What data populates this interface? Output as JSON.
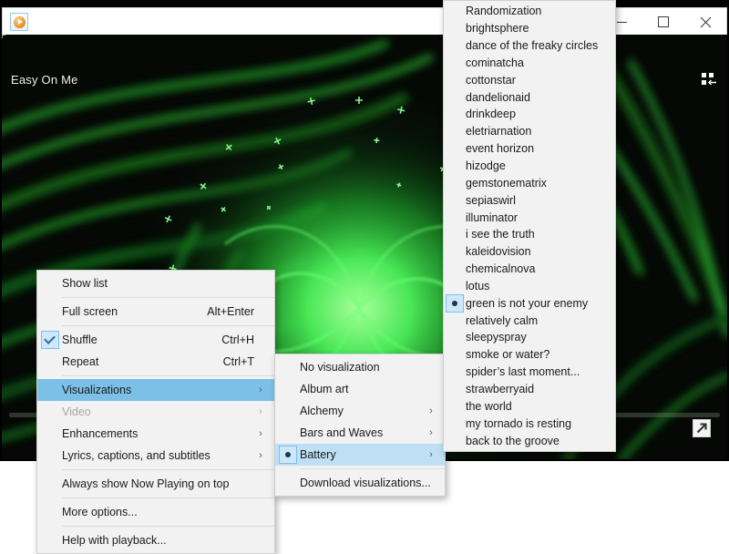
{
  "window": {
    "title": "",
    "app_icon": "media-player-icon",
    "controls": {
      "minimize": "–",
      "maximize": "□",
      "close": "✕"
    }
  },
  "now_playing": {
    "track_title": "Easy On Me",
    "switch_to_library_icon": "switch-to-library-icon",
    "expand_icon": "full-screen-icon",
    "visualization_name": "green is not your enemy",
    "visualization_colors": {
      "background": "#050805",
      "glow": "#2fd94a",
      "bright": "#7dff8a"
    }
  },
  "context_menu": {
    "items": [
      {
        "label": "Show list",
        "accel": "",
        "arrow": false,
        "sep_after": true
      },
      {
        "label": "Full screen",
        "accel": "Alt+Enter",
        "arrow": false,
        "sep_after": true
      },
      {
        "label": "Shuffle",
        "accel": "Ctrl+H",
        "arrow": false,
        "checked": true
      },
      {
        "label": "Repeat",
        "accel": "Ctrl+T",
        "arrow": false,
        "sep_after": true
      },
      {
        "label": "Visualizations",
        "accel": "",
        "arrow": true,
        "selected": true
      },
      {
        "label": "Video",
        "accel": "",
        "arrow": true,
        "disabled": true
      },
      {
        "label": "Enhancements",
        "accel": "",
        "arrow": true
      },
      {
        "label": "Lyrics, captions, and subtitles",
        "accel": "",
        "arrow": true,
        "sep_after": true
      },
      {
        "label": "Always show Now Playing on top",
        "accel": "",
        "arrow": false,
        "sep_after": true
      },
      {
        "label": "More options...",
        "accel": "",
        "arrow": false,
        "sep_after": true
      },
      {
        "label": "Help with playback...",
        "accel": "",
        "arrow": false
      }
    ]
  },
  "visualizations_menu": {
    "items": [
      {
        "label": "No visualization",
        "arrow": false
      },
      {
        "label": "Album art",
        "arrow": false
      },
      {
        "label": "Alchemy",
        "arrow": true
      },
      {
        "label": "Bars and Waves",
        "arrow": true
      },
      {
        "label": "Battery",
        "arrow": true,
        "selected": true,
        "radio": true,
        "sep_after": true
      },
      {
        "label": "Download visualizations...",
        "arrow": false
      }
    ]
  },
  "battery_menu": {
    "items": [
      {
        "label": "Randomization",
        "radio": false
      },
      {
        "label": "brightsphere",
        "radio": false
      },
      {
        "label": "dance of the freaky circles",
        "radio": false
      },
      {
        "label": "cominatcha",
        "radio": false
      },
      {
        "label": "cottonstar",
        "radio": false
      },
      {
        "label": "dandelionaid",
        "radio": false
      },
      {
        "label": "drinkdeep",
        "radio": false
      },
      {
        "label": "eletriarnation",
        "radio": false
      },
      {
        "label": "event horizon",
        "radio": false
      },
      {
        "label": "hizodge",
        "radio": false
      },
      {
        "label": "gemstonematrix",
        "radio": false
      },
      {
        "label": "sepiaswirl",
        "radio": false
      },
      {
        "label": "illuminator",
        "radio": false
      },
      {
        "label": "i see the truth",
        "radio": false
      },
      {
        "label": "kaleidovision",
        "radio": false
      },
      {
        "label": "chemicalnova",
        "radio": false
      },
      {
        "label": "lotus",
        "radio": false
      },
      {
        "label": "green is not your enemy",
        "radio": true
      },
      {
        "label": "relatively calm",
        "radio": false
      },
      {
        "label": "sleepyspray",
        "radio": false
      },
      {
        "label": "smoke or water?",
        "radio": false
      },
      {
        "label": "spider’s last moment...",
        "radio": false
      },
      {
        "label": "strawberryaid",
        "radio": false
      },
      {
        "label": "the world",
        "radio": false
      },
      {
        "label": "my tornado is resting",
        "radio": false
      },
      {
        "label": "back to the groove",
        "radio": false
      }
    ]
  }
}
